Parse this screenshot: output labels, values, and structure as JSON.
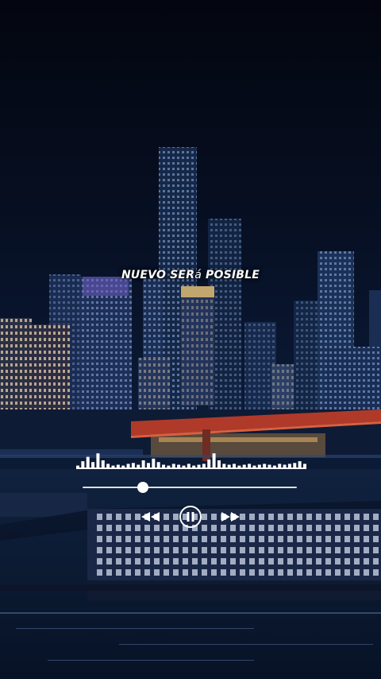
{
  "caption": {
    "part1": "NUEVO SER",
    "part2": "á",
    "part3": " POSIBLE"
  },
  "player": {
    "progress_fraction": 0.28,
    "state": "playing",
    "icons": {
      "rewind": "rewind-icon",
      "pause": "pause-icon",
      "fast_forward": "fast-forward-icon"
    }
  },
  "visualizer": {
    "levels": [
      0.2,
      0.45,
      0.7,
      0.4,
      0.9,
      0.5,
      0.3,
      0.2,
      0.25,
      0.2,
      0.3,
      0.35,
      0.25,
      0.5,
      0.35,
      0.6,
      0.4,
      0.25,
      0.2,
      0.3,
      0.25,
      0.2,
      0.3,
      0.2,
      0.25,
      0.3,
      0.55,
      0.9,
      0.5,
      0.3,
      0.25,
      0.3,
      0.2,
      0.25,
      0.3,
      0.2,
      0.25,
      0.3,
      0.25,
      0.2,
      0.3,
      0.25,
      0.3,
      0.35,
      0.45,
      0.3
    ]
  },
  "colors": {
    "sky": "#050a18",
    "bridge": "#b03a2a",
    "water": "#0b1a33",
    "accent": "#ffffff"
  }
}
